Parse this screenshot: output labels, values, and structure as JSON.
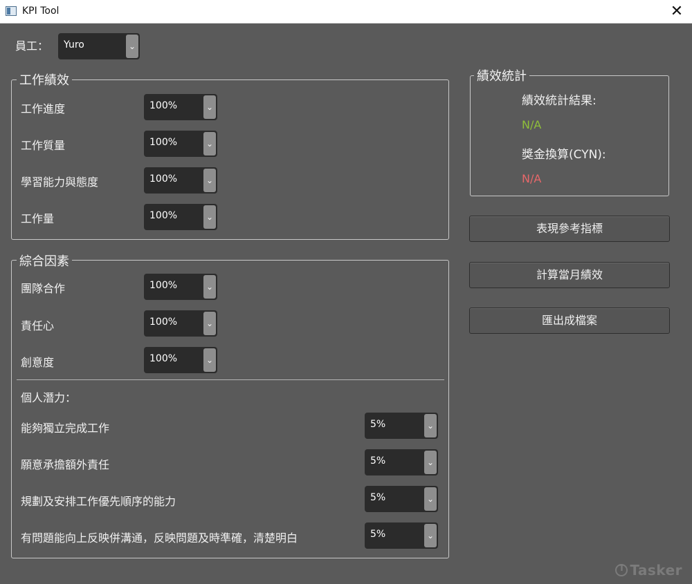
{
  "window": {
    "title": "KPI Tool",
    "close_glyph": "✕"
  },
  "employee": {
    "label": "員工：",
    "selected": "Yuro"
  },
  "work_performance": {
    "title": "工作績效",
    "rows": [
      {
        "label": "工作進度",
        "value": "100%"
      },
      {
        "label": "工作質量",
        "value": "100%"
      },
      {
        "label": "學習能力與態度",
        "value": "100%"
      },
      {
        "label": "工作量",
        "value": "100%"
      }
    ]
  },
  "overall_factors": {
    "title": "綜合因素",
    "rows": [
      {
        "label": "團隊合作",
        "value": "100%"
      },
      {
        "label": "責任心",
        "value": "100%"
      },
      {
        "label": "創意度",
        "value": "100%"
      }
    ],
    "potential_label": "個人潛力：",
    "potential_rows": [
      {
        "label": "能夠獨立完成工作",
        "value": "5%"
      },
      {
        "label": "願意承擔額外責任",
        "value": "5%"
      },
      {
        "label": "規劃及安排工作優先順序的能力",
        "value": "5%"
      },
      {
        "label": "有問題能向上反映併溝通，反映問題及時準確，清楚明白",
        "value": "5%"
      }
    ]
  },
  "stats": {
    "title": "績效統計",
    "result_label": "績效統計結果:",
    "result_value": "N/A",
    "bonus_label": "獎金換算(CYN):",
    "bonus_value": "N/A",
    "colors": {
      "result": "#8fbf3a",
      "bonus": "#e8686a"
    }
  },
  "buttons": {
    "reference": "表現參考指標",
    "calculate": "計算當月績效",
    "export": "匯出成檔案"
  },
  "watermark": {
    "text": "Tasker"
  },
  "icons": {
    "combo_arrow": "chevron-down-icon",
    "app": "app-window-icon",
    "close": "close-icon"
  }
}
